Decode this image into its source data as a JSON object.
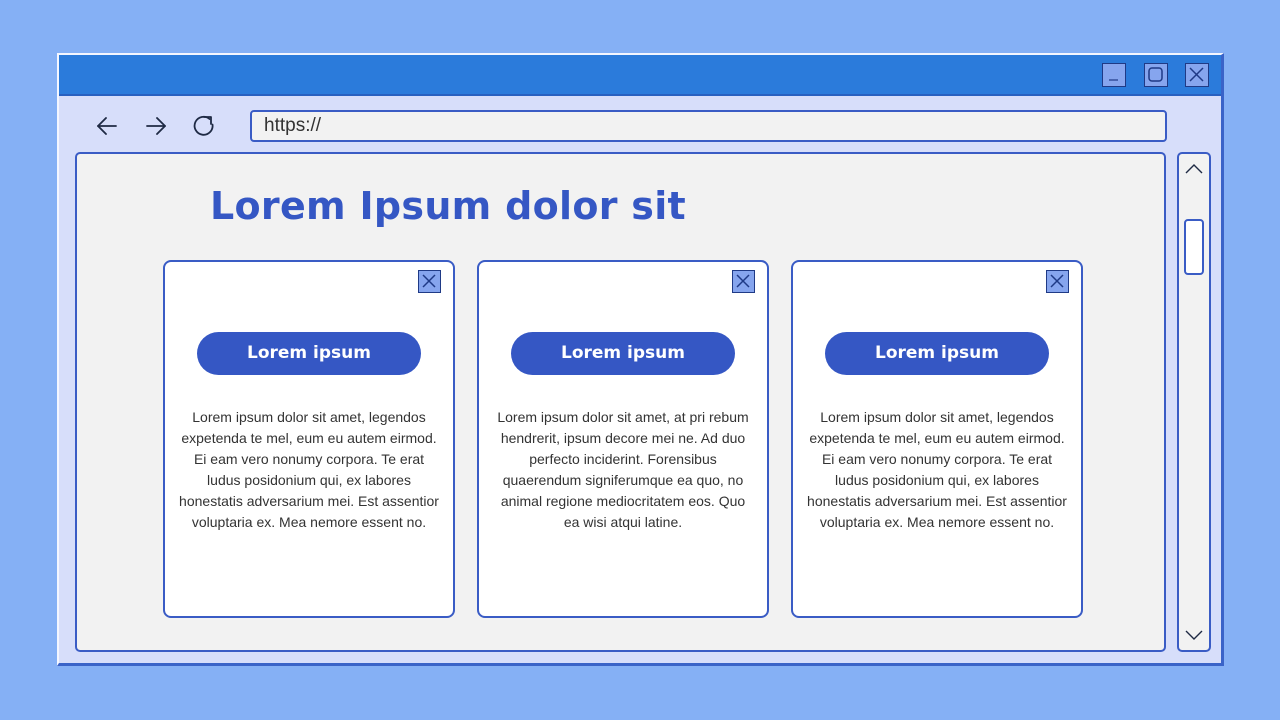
{
  "window": {
    "controls": {
      "minimize_icon": "minimize-icon",
      "maximize_icon": "maximize-icon",
      "close_icon": "close-icon"
    }
  },
  "toolbar": {
    "back_icon": "arrow-left-icon",
    "forward_icon": "arrow-right-icon",
    "reload_icon": "refresh-icon",
    "address_value": "https://"
  },
  "page": {
    "title": "Lorem Ipsum dolor sit",
    "cards": [
      {
        "button_label": "Lorem ipsum",
        "body": "Lorem ipsum dolor sit amet, legendos expetenda te mel, eum eu autem eirmod. Ei eam vero nonumy corpora. Te erat ludus posidonium qui, ex labores honestatis adversarium mei. Est assentior voluptaria ex. Mea nemore essent no."
      },
      {
        "button_label": "Lorem ipsum",
        "body": "Lorem ipsum dolor sit amet, at pri rebum hendrerit, ipsum decore mei ne. Ad duo perfecto inciderint. Forensibus quaerendum signiferumque ea quo, no animal regione mediocritatem eos. Quo ea wisi atqui latine."
      },
      {
        "button_label": "Lorem ipsum",
        "body": "Lorem ipsum dolor sit amet, legendos expetenda te mel, eum eu autem eirmod. Ei eam vero nonumy corpora. Te erat ludus posidonium qui, ex labores honestatis adversarium mei. Est assentior voluptaria ex. Mea nemore essent no."
      }
    ]
  },
  "scrollbar": {
    "up_icon": "chevron-up-icon",
    "down_icon": "chevron-down-icon"
  },
  "colors": {
    "background": "#85b0f5",
    "titlebar": "#2b7bdb",
    "accent": "#3557c4",
    "window_button": "#86a5ee",
    "content_background": "#f2f2f2",
    "card_background": "#ffffff"
  }
}
